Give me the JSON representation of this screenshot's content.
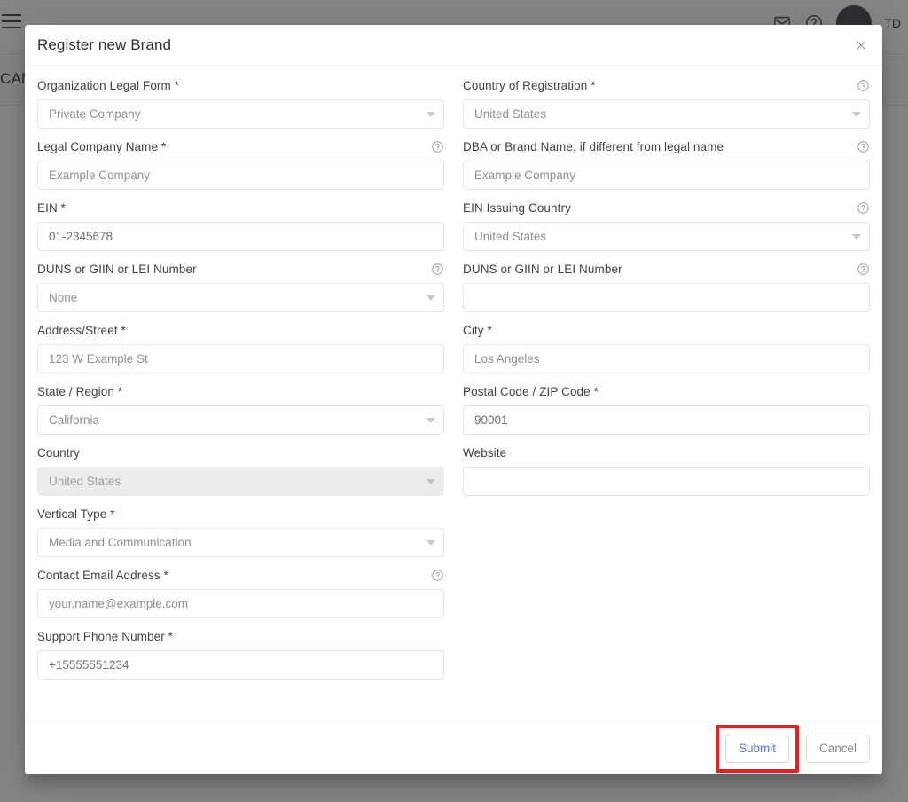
{
  "background": {
    "menu_icon": "hamburger-menu-icon",
    "campaign_text": "CAM",
    "user_initials": "TD",
    "icons": [
      "mail-icon",
      "help-circle-icon",
      "avatar-icon"
    ]
  },
  "dialog": {
    "title": "Register new Brand",
    "close_icon": "close-icon",
    "footer": {
      "submit_label": "Submit",
      "cancel_label": "Cancel",
      "highlight_color": "#ef1d1d",
      "submit_text_color": "#5a6ee0"
    }
  },
  "fields": {
    "left": [
      {
        "label": "Organization Legal Form *",
        "type": "select",
        "value": "Private Company",
        "help": false,
        "disabled": false,
        "filled": false
      },
      {
        "label": "Legal Company Name *",
        "type": "text",
        "value": "Example Company",
        "help": true,
        "disabled": false,
        "filled": false
      },
      {
        "label": "EIN *",
        "type": "text",
        "value": "01-2345678",
        "help": false,
        "disabled": false,
        "filled": true
      },
      {
        "label": "DUNS or GIIN or LEI Number",
        "type": "select",
        "value": "None",
        "help": true,
        "disabled": false,
        "filled": false
      },
      {
        "label": "Address/Street *",
        "type": "text",
        "value": "123 W Example St",
        "help": false,
        "disabled": false,
        "filled": false
      },
      {
        "label": "State / Region *",
        "type": "select",
        "value": "California",
        "help": false,
        "disabled": false,
        "filled": false
      },
      {
        "label": "Country",
        "type": "select",
        "value": "United States",
        "help": false,
        "disabled": true,
        "filled": false
      },
      {
        "label": "Vertical Type *",
        "type": "select",
        "value": "Media and Communication",
        "help": false,
        "disabled": false,
        "filled": false
      },
      {
        "label": "Contact Email Address *",
        "type": "text",
        "value": "your.name@example.com",
        "help": true,
        "disabled": false,
        "filled": false
      },
      {
        "label": "Support Phone Number *",
        "type": "text",
        "value": "+15555551234",
        "help": false,
        "disabled": false,
        "filled": true
      }
    ],
    "right": [
      {
        "label": "Country of Registration *",
        "type": "select",
        "value": "United States",
        "help": true,
        "disabled": false,
        "filled": false
      },
      {
        "label": "DBA or Brand Name, if different from legal name",
        "type": "text",
        "value": "Example Company",
        "help": true,
        "disabled": false,
        "filled": false
      },
      {
        "label": "EIN Issuing Country",
        "type": "select",
        "value": "United States",
        "help": true,
        "disabled": false,
        "filled": false
      },
      {
        "label": "DUNS or GIIN or LEI Number",
        "type": "text",
        "value": "",
        "help": true,
        "disabled": false,
        "filled": false
      },
      {
        "label": "City *",
        "type": "text",
        "value": "Los Angeles",
        "help": false,
        "disabled": false,
        "filled": false
      },
      {
        "label": "Postal Code / ZIP Code *",
        "type": "text",
        "value": "90001",
        "help": false,
        "disabled": false,
        "filled": true
      },
      {
        "label": "Website",
        "type": "text",
        "value": "",
        "help": false,
        "disabled": false,
        "filled": false
      }
    ]
  }
}
